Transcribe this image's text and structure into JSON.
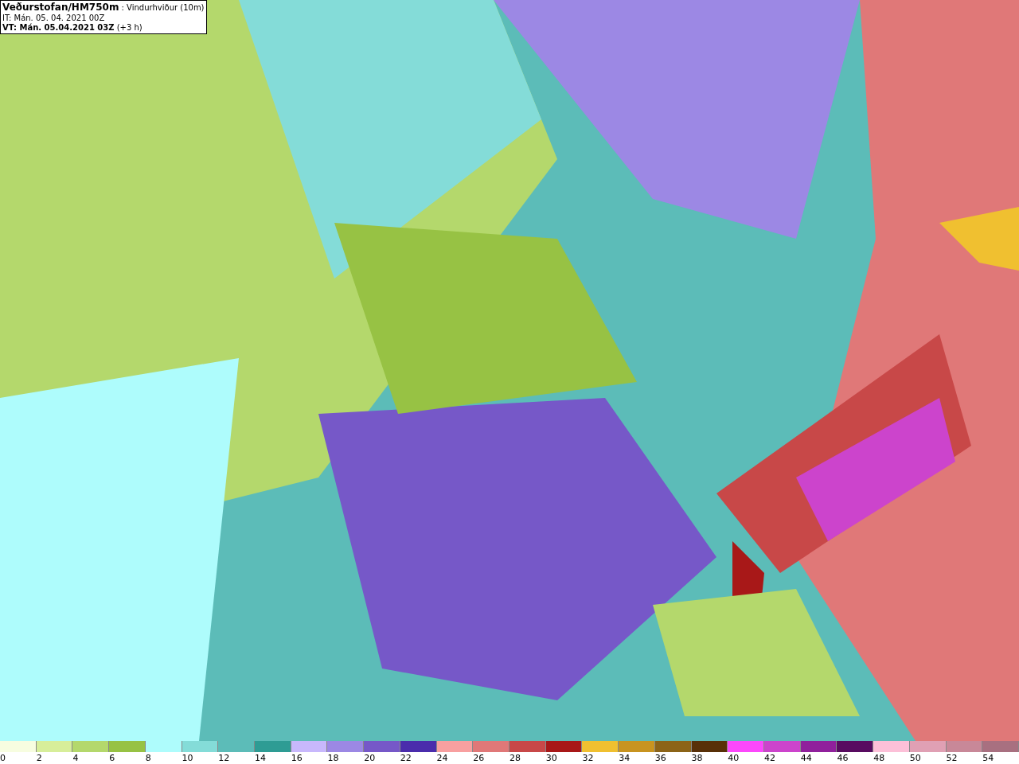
{
  "header": {
    "title": "**Veðurstofan/HM750m** : Vindurhviður (10m)",
    "initial_time": "IT: Mán. 05. 04. 2021 00Z",
    "valid_time": "**VT: Mán. 05.04.2021 03Z** (+3 h)"
  },
  "legend": [
    {
      "label": "0",
      "color": "#f7fde0"
    },
    {
      "label": "2",
      "color": "#d7ee9a"
    },
    {
      "label": "4",
      "color": "#b4d86c"
    },
    {
      "label": "6",
      "color": "#97c244"
    },
    {
      "label": "8",
      "color": "#aefcfc"
    },
    {
      "label": "10",
      "color": "#84dcd8"
    },
    {
      "label": "12",
      "color": "#5cbcb8"
    },
    {
      "label": "14",
      "color": "#2e9c94"
    },
    {
      "label": "16",
      "color": "#c8b8fc"
    },
    {
      "label": "18",
      "color": "#9c88e4"
    },
    {
      "label": "20",
      "color": "#7658c8"
    },
    {
      "label": "22",
      "color": "#4a2cac"
    },
    {
      "label": "24",
      "color": "#f8a0a0"
    },
    {
      "label": "26",
      "color": "#e07878"
    },
    {
      "label": "28",
      "color": "#c84848"
    },
    {
      "label": "30",
      "color": "#a81818"
    },
    {
      "label": "32",
      "color": "#f0c030"
    },
    {
      "label": "34",
      "color": "#c89420"
    },
    {
      "label": "36",
      "color": "#8c6418"
    },
    {
      "label": "38",
      "color": "#583008"
    },
    {
      "label": "40",
      "color": "#fc48fc"
    },
    {
      "label": "42",
      "color": "#cc44cc"
    },
    {
      "label": "44",
      "color": "#90209c"
    },
    {
      "label": "46",
      "color": "#580c60"
    },
    {
      "label": "48",
      "color": "#fcc0d8"
    },
    {
      "label": "50",
      "color": "#e0a0b4"
    },
    {
      "label": "52",
      "color": "#c88898"
    },
    {
      "label": "54",
      "color": "#a87080"
    }
  ]
}
